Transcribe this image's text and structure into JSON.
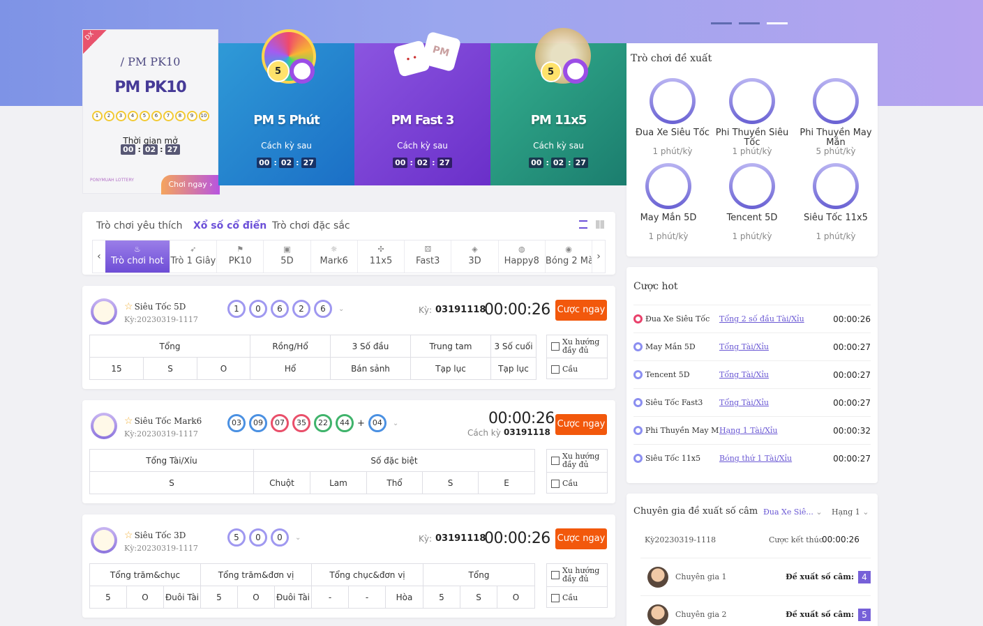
{
  "banner": {
    "cards": [
      {
        "badge": "DX",
        "subtitle": "/ PM PK10",
        "title": "PM PK10",
        "numbers": [
          "1",
          "2",
          "3",
          "4",
          "5",
          "6",
          "7",
          "8",
          "9",
          "10"
        ],
        "label": "Thời gian mở",
        "countdown": [
          "00",
          "02",
          "27"
        ],
        "logo": "PONYMUAH LOTTERY",
        "play": "Chơi ngay"
      },
      {
        "title": "PM 5 Phút",
        "label": "Cách kỳ sau",
        "countdown": [
          "00",
          "02",
          "27"
        ]
      },
      {
        "title": "PM Fast 3",
        "label": "Cách kỳ sau",
        "countdown": [
          "00",
          "02",
          "27"
        ]
      },
      {
        "title": "PM 11x5",
        "label": "Cách kỳ sau",
        "countdown": [
          "00",
          "02",
          "27"
        ]
      }
    ]
  },
  "recommend": {
    "title": "Trò chơi đề xuất",
    "items": [
      {
        "name": "Đua Xe Siêu Tốc",
        "period": "1 phút/kỳ"
      },
      {
        "name": "Phi Thuyền Siêu Tốc",
        "period": "1 phút/kỳ"
      },
      {
        "name": "Phi Thuyền May Mắn",
        "period": "5 phút/kỳ"
      },
      {
        "name": "May Mắn 5D",
        "period": "1 phút/kỳ"
      },
      {
        "name": "Tencent 5D",
        "period": "1 phút/kỳ"
      },
      {
        "name": "Siêu Tốc 11x5",
        "period": "1 phút/kỳ"
      }
    ]
  },
  "hot": {
    "title": "Cược hot",
    "rows": [
      {
        "name": "Đua Xe Siêu Tốc",
        "bet": "Tổng 2 số đầu Tài/Xỉu",
        "time": "00:00:26"
      },
      {
        "name": "May Mắn 5D",
        "bet": "Tổng Tài/Xỉu",
        "time": "00:00:27"
      },
      {
        "name": "Tencent 5D",
        "bet": "Tổng Tài/Xỉu",
        "time": "00:00:27"
      },
      {
        "name": "Siêu Tốc Fast3",
        "bet": "Tổng Tài/Xỉu",
        "time": "00:00:27"
      },
      {
        "name": "Phi Thuyền May Mắn",
        "bet": "Hạng 1 Tài/Xỉu",
        "time": "00:00:32"
      },
      {
        "name": "Siêu Tốc 11x5",
        "bet": "Bóng thứ 1 Tài/Xỉu",
        "time": "00:00:27"
      }
    ]
  },
  "expert": {
    "title": "Chuyên gia đề xuất số câm",
    "game_select": "Đua Xe Siê...",
    "rank_select": "Hạng 1",
    "period": "Kỳ20230319-1118",
    "end_label": "Cược kết thúc",
    "end_time": "00:00:26",
    "rows": [
      {
        "name": "Chuyên gia 1",
        "label": "Đề xuất số câm:",
        "value": "4"
      },
      {
        "name": "Chuyên gia 2",
        "label": "Đề xuất số câm:",
        "value": "5"
      }
    ]
  },
  "tabs": {
    "top": [
      "Trò chơi yêu thích",
      "Xổ số cổ điển",
      "Trò chơi đặc sắc"
    ],
    "categories": [
      "Trò chơi hot",
      "Trò 1 Giây",
      "PK10",
      "5D",
      "Mark6",
      "11x5",
      "Fast3",
      "3D",
      "Happy8",
      "Bóng 2 Mà"
    ]
  },
  "lotteries": [
    {
      "name": "Siêu Tốc 5D",
      "ky": "Kỳ:20230319-1117",
      "balls": [
        "1",
        "0",
        "6",
        "2",
        "6"
      ],
      "ky_label": "Kỳ:",
      "ky_value": "03191118",
      "timer": "00:00:26",
      "bet": "Cược ngay",
      "headers": [
        "Tổng",
        "Rồng/Hổ",
        "3 Số đầu",
        "Trung tam",
        "3 Số cuối"
      ],
      "cells": [
        "15",
        "S",
        "O",
        "Hổ",
        "Bán sảnh",
        "Tạp lục",
        "Tạp lục"
      ],
      "side": [
        "Xu hướng đầy đủ",
        "Cầu"
      ]
    },
    {
      "name": "Siêu Tốc Mark6",
      "ky": "Kỳ:20230319-1117",
      "balls": [
        "03",
        "09",
        "07",
        "35",
        "22",
        "44",
        "04"
      ],
      "ky_label": "Cách kỳ",
      "ky_value": "03191118",
      "timer": "00:00:26",
      "bet": "Cược ngay",
      "headers": [
        "Tổng Tài/Xỉu",
        "Số đặc biệt"
      ],
      "cells": [
        "S",
        "Chuột",
        "Lam",
        "Thổ",
        "S",
        "E"
      ],
      "side": [
        "Xu hướng đầy đủ",
        "Cầu"
      ]
    },
    {
      "name": "Siêu Tốc 3D",
      "ky": "Kỳ:20230319-1117",
      "balls": [
        "5",
        "0",
        "0"
      ],
      "ky_label": "Kỳ:",
      "ky_value": "03191118",
      "timer": "00:00:26",
      "bet": "Cược ngay",
      "headers": [
        "Tổng trăm&chục",
        "Tổng trăm&đơn vị",
        "Tổng chục&đơn vị",
        "Tổng"
      ],
      "cells": [
        "5",
        "O",
        "Đuôi Tài",
        "5",
        "O",
        "Đuôi Tài",
        "-",
        "-",
        "Hòa",
        "5",
        "S",
        "O"
      ],
      "side": [
        "Xu hướng đầy đủ",
        "Cầu"
      ]
    }
  ],
  "colors": {
    "accent": "#6b4fd8",
    "bet": "#f2580c",
    "mark6": [
      "#4a90e2",
      "#4a90e2",
      "#e94f6a",
      "#e94f6a",
      "#3fb36b",
      "#3fb36b",
      "#4a90e2"
    ]
  }
}
